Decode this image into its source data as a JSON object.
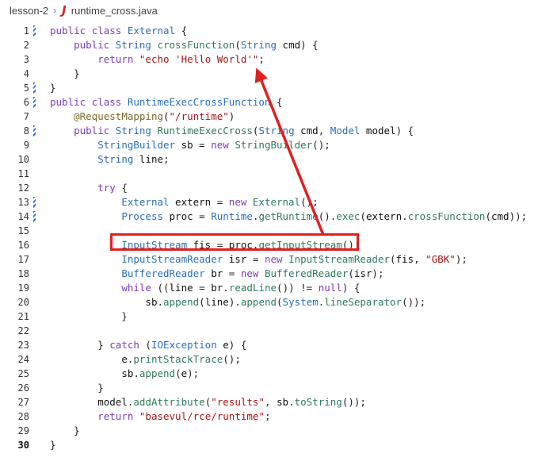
{
  "breadcrumb": {
    "folder": "lesson-2",
    "file_icon": "J",
    "file": "runtime_cross.java"
  },
  "colors": {
    "keyword": "#7e3bb5",
    "type": "#2b6fb3",
    "function": "#2d7a5a",
    "string": "#a31515",
    "annotation": "#7a6a2a",
    "highlight": "#e02020",
    "change_marker": "#1f6feb"
  },
  "editor": {
    "current_line": 30,
    "lines": [
      {
        "n": "1",
        "mark": true,
        "tokens": [
          [
            "kw",
            "public "
          ],
          [
            "kw",
            "class "
          ],
          [
            "ty",
            "External "
          ],
          [
            "p",
            "{"
          ]
        ]
      },
      {
        "n": "2",
        "mark": false,
        "tokens": [
          [
            "p",
            "    "
          ],
          [
            "kw",
            "public "
          ],
          [
            "ty",
            "String "
          ],
          [
            "fn",
            "crossFunction"
          ],
          [
            "p",
            "("
          ],
          [
            "ty",
            "String "
          ],
          [
            "id",
            "cmd"
          ],
          [
            "p",
            ") {"
          ]
        ]
      },
      {
        "n": "3",
        "mark": false,
        "tokens": [
          [
            "p",
            "        "
          ],
          [
            "kw",
            "return "
          ],
          [
            "str",
            "\"echo 'Hello World'\""
          ],
          [
            "p",
            ";"
          ]
        ]
      },
      {
        "n": "4",
        "mark": false,
        "tokens": [
          [
            "p",
            "    }"
          ]
        ]
      },
      {
        "n": "5",
        "mark": true,
        "tokens": [
          [
            "p",
            "}"
          ]
        ]
      },
      {
        "n": "6",
        "mark": true,
        "tokens": [
          [
            "kw",
            "public "
          ],
          [
            "kw",
            "class "
          ],
          [
            "ty",
            "RuntimeExecCrossFunction "
          ],
          [
            "p",
            "{"
          ]
        ]
      },
      {
        "n": "7",
        "mark": false,
        "tokens": [
          [
            "p",
            "    "
          ],
          [
            "an",
            "@RequestMapping"
          ],
          [
            "p",
            "("
          ],
          [
            "str",
            "\"/runtime\""
          ],
          [
            "p",
            ")"
          ]
        ]
      },
      {
        "n": "8",
        "mark": true,
        "tokens": [
          [
            "p",
            "    "
          ],
          [
            "kw",
            "public "
          ],
          [
            "ty",
            "String "
          ],
          [
            "fn",
            "RuntimeExecCross"
          ],
          [
            "p",
            "("
          ],
          [
            "ty",
            "String "
          ],
          [
            "id",
            "cmd"
          ],
          [
            "p",
            ", "
          ],
          [
            "ty",
            "Model "
          ],
          [
            "id",
            "model"
          ],
          [
            "p",
            ") {"
          ]
        ]
      },
      {
        "n": "9",
        "mark": false,
        "tokens": [
          [
            "p",
            "        "
          ],
          [
            "ty",
            "StringBuilder "
          ],
          [
            "id",
            "sb "
          ],
          [
            "p",
            "= "
          ],
          [
            "kw",
            "new "
          ],
          [
            "fn",
            "StringBuilder"
          ],
          [
            "p",
            "();"
          ]
        ]
      },
      {
        "n": "10",
        "mark": false,
        "tokens": [
          [
            "p",
            "        "
          ],
          [
            "ty",
            "String "
          ],
          [
            "id",
            "line"
          ],
          [
            "p",
            ";"
          ]
        ]
      },
      {
        "n": "11",
        "mark": false,
        "tokens": []
      },
      {
        "n": "12",
        "mark": false,
        "tokens": [
          [
            "p",
            "        "
          ],
          [
            "kw",
            "try "
          ],
          [
            "p",
            "{"
          ]
        ]
      },
      {
        "n": "13",
        "mark": true,
        "tokens": [
          [
            "p",
            "            "
          ],
          [
            "ty",
            "External "
          ],
          [
            "id",
            "extern "
          ],
          [
            "p",
            "= "
          ],
          [
            "kw",
            "new "
          ],
          [
            "fn",
            "External"
          ],
          [
            "p",
            "();"
          ]
        ]
      },
      {
        "n": "14",
        "mark": true,
        "tokens": [
          [
            "p",
            "            "
          ],
          [
            "ty",
            "Process "
          ],
          [
            "id",
            "proc "
          ],
          [
            "p",
            "= "
          ],
          [
            "ty",
            "Runtime"
          ],
          [
            "p",
            "."
          ],
          [
            "fn",
            "getRuntime"
          ],
          [
            "p",
            "()."
          ],
          [
            "fn",
            "exec"
          ],
          [
            "p",
            "("
          ],
          [
            "id",
            "extern"
          ],
          [
            "p",
            "."
          ],
          [
            "fn",
            "crossFunction"
          ],
          [
            "p",
            "("
          ],
          [
            "id",
            "cmd"
          ],
          [
            "p",
            "));"
          ]
        ]
      },
      {
        "n": "15",
        "mark": false,
        "tokens": []
      },
      {
        "n": "16",
        "mark": false,
        "tokens": [
          [
            "p",
            "            "
          ],
          [
            "ty",
            "InputStream "
          ],
          [
            "id",
            "fis "
          ],
          [
            "p",
            "= "
          ],
          [
            "id",
            "proc"
          ],
          [
            "p",
            "."
          ],
          [
            "fn",
            "getInputStream"
          ],
          [
            "p",
            "();"
          ]
        ]
      },
      {
        "n": "17",
        "mark": false,
        "tokens": [
          [
            "p",
            "            "
          ],
          [
            "ty",
            "InputStreamReader "
          ],
          [
            "id",
            "isr "
          ],
          [
            "p",
            "= "
          ],
          [
            "kw",
            "new "
          ],
          [
            "fn",
            "InputStreamReader"
          ],
          [
            "p",
            "("
          ],
          [
            "id",
            "fis"
          ],
          [
            "p",
            ", "
          ],
          [
            "str",
            "\"GBK\""
          ],
          [
            "p",
            ");"
          ]
        ]
      },
      {
        "n": "18",
        "mark": false,
        "tokens": [
          [
            "p",
            "            "
          ],
          [
            "ty",
            "BufferedReader "
          ],
          [
            "id",
            "br "
          ],
          [
            "p",
            "= "
          ],
          [
            "kw",
            "new "
          ],
          [
            "fn",
            "BufferedReader"
          ],
          [
            "p",
            "("
          ],
          [
            "id",
            "isr"
          ],
          [
            "p",
            ");"
          ]
        ]
      },
      {
        "n": "19",
        "mark": false,
        "tokens": [
          [
            "p",
            "            "
          ],
          [
            "kw",
            "while "
          ],
          [
            "p",
            "(("
          ],
          [
            "id",
            "line "
          ],
          [
            "p",
            "= "
          ],
          [
            "id",
            "br"
          ],
          [
            "p",
            "."
          ],
          [
            "fn",
            "readLine"
          ],
          [
            "p",
            "()) != "
          ],
          [
            "kw",
            "null"
          ],
          [
            "p",
            ") {"
          ]
        ]
      },
      {
        "n": "20",
        "mark": false,
        "tokens": [
          [
            "p",
            "                "
          ],
          [
            "id",
            "sb"
          ],
          [
            "p",
            "."
          ],
          [
            "fn",
            "append"
          ],
          [
            "p",
            "("
          ],
          [
            "id",
            "line"
          ],
          [
            "p",
            ")."
          ],
          [
            "fn",
            "append"
          ],
          [
            "p",
            "("
          ],
          [
            "ty",
            "System"
          ],
          [
            "p",
            "."
          ],
          [
            "fn",
            "lineSeparator"
          ],
          [
            "p",
            "());"
          ]
        ]
      },
      {
        "n": "21",
        "mark": false,
        "tokens": [
          [
            "p",
            "            }"
          ]
        ]
      },
      {
        "n": "22",
        "mark": false,
        "tokens": []
      },
      {
        "n": "23",
        "mark": false,
        "tokens": [
          [
            "p",
            "        } "
          ],
          [
            "kw",
            "catch "
          ],
          [
            "p",
            "("
          ],
          [
            "ty",
            "IOException "
          ],
          [
            "id",
            "e"
          ],
          [
            "p",
            ") {"
          ]
        ]
      },
      {
        "n": "24",
        "mark": false,
        "tokens": [
          [
            "p",
            "            "
          ],
          [
            "id",
            "e"
          ],
          [
            "p",
            "."
          ],
          [
            "fn",
            "printStackTrace"
          ],
          [
            "p",
            "();"
          ]
        ]
      },
      {
        "n": "25",
        "mark": false,
        "tokens": [
          [
            "p",
            "            "
          ],
          [
            "id",
            "sb"
          ],
          [
            "p",
            "."
          ],
          [
            "fn",
            "append"
          ],
          [
            "p",
            "("
          ],
          [
            "id",
            "e"
          ],
          [
            "p",
            ");"
          ]
        ]
      },
      {
        "n": "26",
        "mark": false,
        "tokens": [
          [
            "p",
            "        }"
          ]
        ]
      },
      {
        "n": "27",
        "mark": false,
        "tokens": [
          [
            "p",
            "        "
          ],
          [
            "id",
            "model"
          ],
          [
            "p",
            "."
          ],
          [
            "fn",
            "addAttribute"
          ],
          [
            "p",
            "("
          ],
          [
            "str",
            "\"results\""
          ],
          [
            "p",
            ", "
          ],
          [
            "id",
            "sb"
          ],
          [
            "p",
            "."
          ],
          [
            "fn",
            "toString"
          ],
          [
            "p",
            "());"
          ]
        ]
      },
      {
        "n": "28",
        "mark": false,
        "tokens": [
          [
            "p",
            "        "
          ],
          [
            "kw",
            "return "
          ],
          [
            "str",
            "\"basevul/rce/runtime\""
          ],
          [
            "p",
            ";"
          ]
        ]
      },
      {
        "n": "29",
        "mark": false,
        "tokens": [
          [
            "p",
            "    }"
          ]
        ]
      },
      {
        "n": "30",
        "mark": false,
        "tokens": [
          [
            "p",
            "}"
          ]
        ]
      }
    ]
  }
}
